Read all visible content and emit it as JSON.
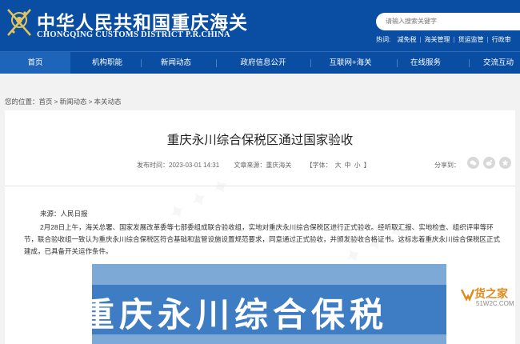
{
  "header": {
    "title_cn": "中华人民共和国重庆海关",
    "title_en": "CHONGQING CUSTOMS DISTRICT P.R.CHINA",
    "search_placeholder": "请输入搜索关键字",
    "hot_label": "热词:",
    "hot_words": [
      "减免税",
      "海关管理",
      "货运监管",
      "行政审"
    ]
  },
  "nav": {
    "items": [
      {
        "label": "首页",
        "active": true
      },
      {
        "label": "机构职能"
      },
      {
        "label": "新闻动态"
      },
      {
        "label": "政府信息公开"
      },
      {
        "label": "互联网+海关"
      },
      {
        "label": "在线服务"
      },
      {
        "label": "交流互动"
      }
    ]
  },
  "breadcrumb": {
    "prefix": "您的位置：",
    "items": [
      "首页",
      "新闻动态",
      "本关动态"
    ],
    "separator": ">"
  },
  "article": {
    "title": "重庆永川综合保税区通过国家验收",
    "published": "发布时间：2023-03-01 14:31",
    "source": "文章来源：重庆海关",
    "font_label": "【字体：",
    "font_large": "大",
    "font_medium": "中",
    "font_small": "小",
    "font_close": "】",
    "share_label": "分享到：",
    "source_line": "来源：人民日报",
    "body": "2月28日上午，海关总署、国家发展改革委等七部委组成联合验收组，实地对重庆永川综合保税区进行正式验收。经听取汇报、实地检查、组织评审等环节，联合验收组一致认为重庆永川综合保税区符合基础和监管设施设置规范要求，同意通过正式验收，并颁发验收合格证书。这标志着重庆永川综合保税区正式建成，已具备开关运作条件。",
    "photo_text": "重庆永川综合保税"
  },
  "watermark_site": {
    "cn": "货之家",
    "en": "51W2C.COM"
  },
  "colors": {
    "header_bg": "#0a4ea3",
    "nav_active_bg": "#1e64b8",
    "site_mark": "#e08a1e"
  }
}
